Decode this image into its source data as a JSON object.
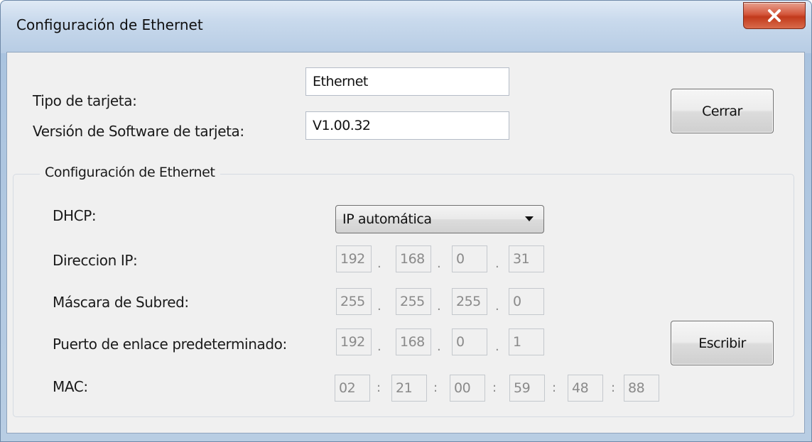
{
  "window": {
    "title": "Configuración de Ethernet",
    "close_icon": "close-x-icon"
  },
  "card": {
    "type_label": "Tipo de tarjeta:",
    "type_value": "Ethernet",
    "version_label": "Versión de Software de tarjeta:",
    "version_value": "V1.00.32"
  },
  "buttons": {
    "close_label": "Cerrar",
    "write_label": "Escribir"
  },
  "ethernet": {
    "group_title": "Configuración de Ethernet",
    "dhcp_label": "DHCP:",
    "dhcp_selected": "IP automática",
    "ip_label": "Direccion IP:",
    "ip": [
      "192",
      "168",
      "0",
      "31"
    ],
    "mask_label": "Máscara de Subred:",
    "mask": [
      "255",
      "255",
      "255",
      "0"
    ],
    "gateway_label": "Puerto de enlace predeterminado:",
    "gateway": [
      "192",
      "168",
      "0",
      "1"
    ],
    "mac_label": "MAC:",
    "mac": [
      "02",
      "21",
      "00",
      "59",
      "48",
      "88"
    ],
    "ip_separator": ".",
    "mac_separator": ":"
  },
  "colors": {
    "close_button": "#c9452a",
    "dialog_background": "#f0f0f0",
    "disabled_text": "#8a8a8a"
  }
}
